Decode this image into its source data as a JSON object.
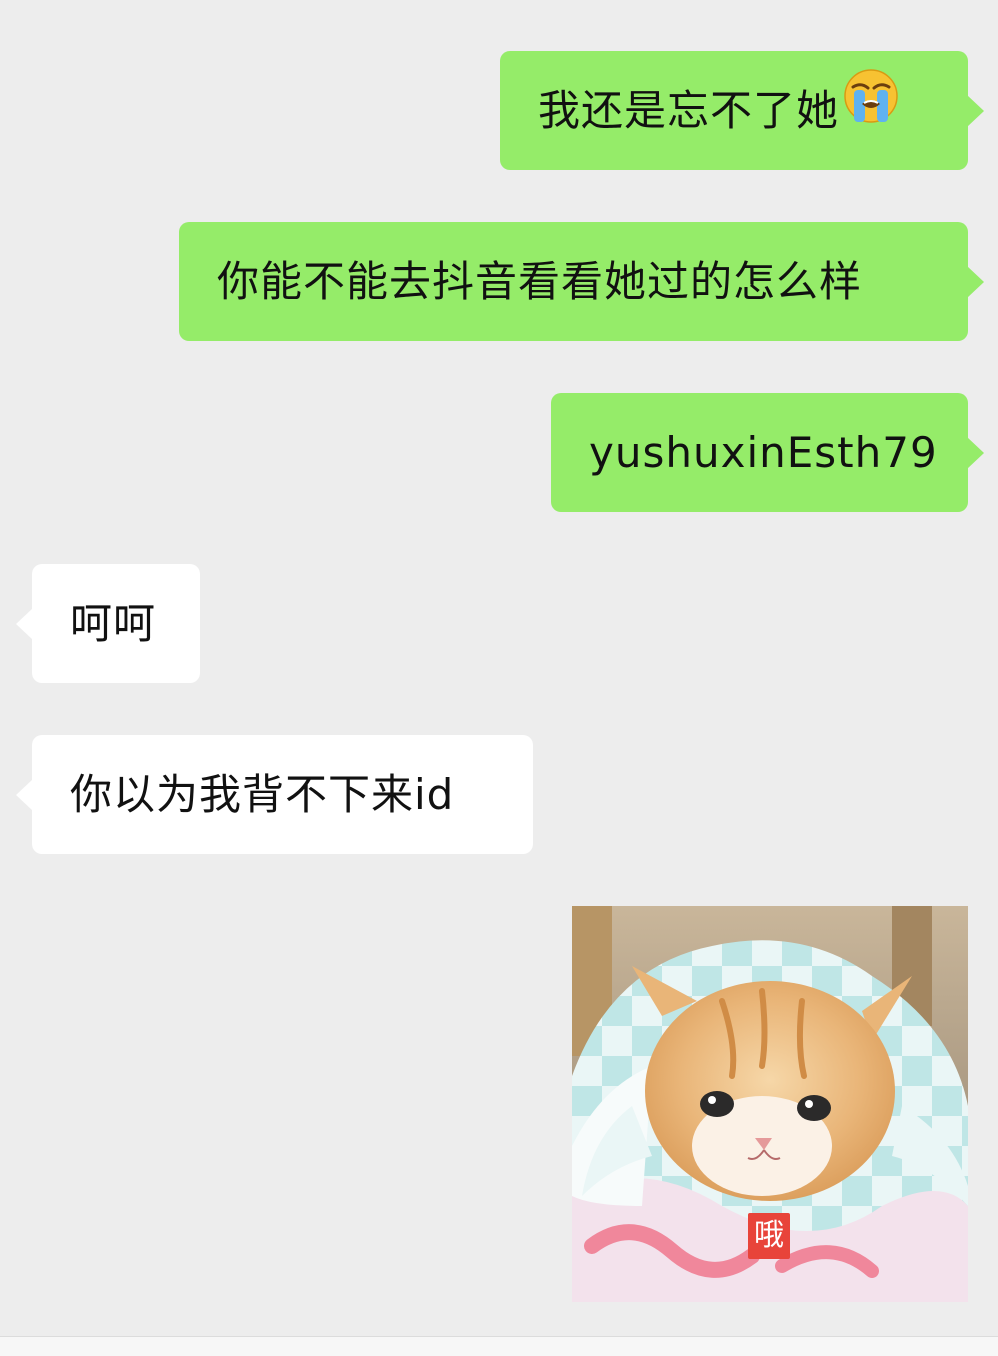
{
  "messages": [
    {
      "side": "out",
      "text": "我还是忘不了她",
      "emoji": "loudly-crying-face"
    },
    {
      "side": "out",
      "text": "你能不能去抖音看看她过的怎么样"
    },
    {
      "side": "out",
      "text": "yushuxinEsth79"
    },
    {
      "side": "in",
      "text": "呵呵"
    },
    {
      "side": "in",
      "text": "你以为我背不下来id"
    },
    {
      "side": "out",
      "type": "sticker",
      "description": "kitten-in-blanket",
      "caption": "哦"
    }
  ],
  "colors": {
    "background": "#ededed",
    "outgoing_bubble": "#95ec69",
    "incoming_bubble": "#ffffff",
    "sticker_tag": "#e8443a"
  }
}
